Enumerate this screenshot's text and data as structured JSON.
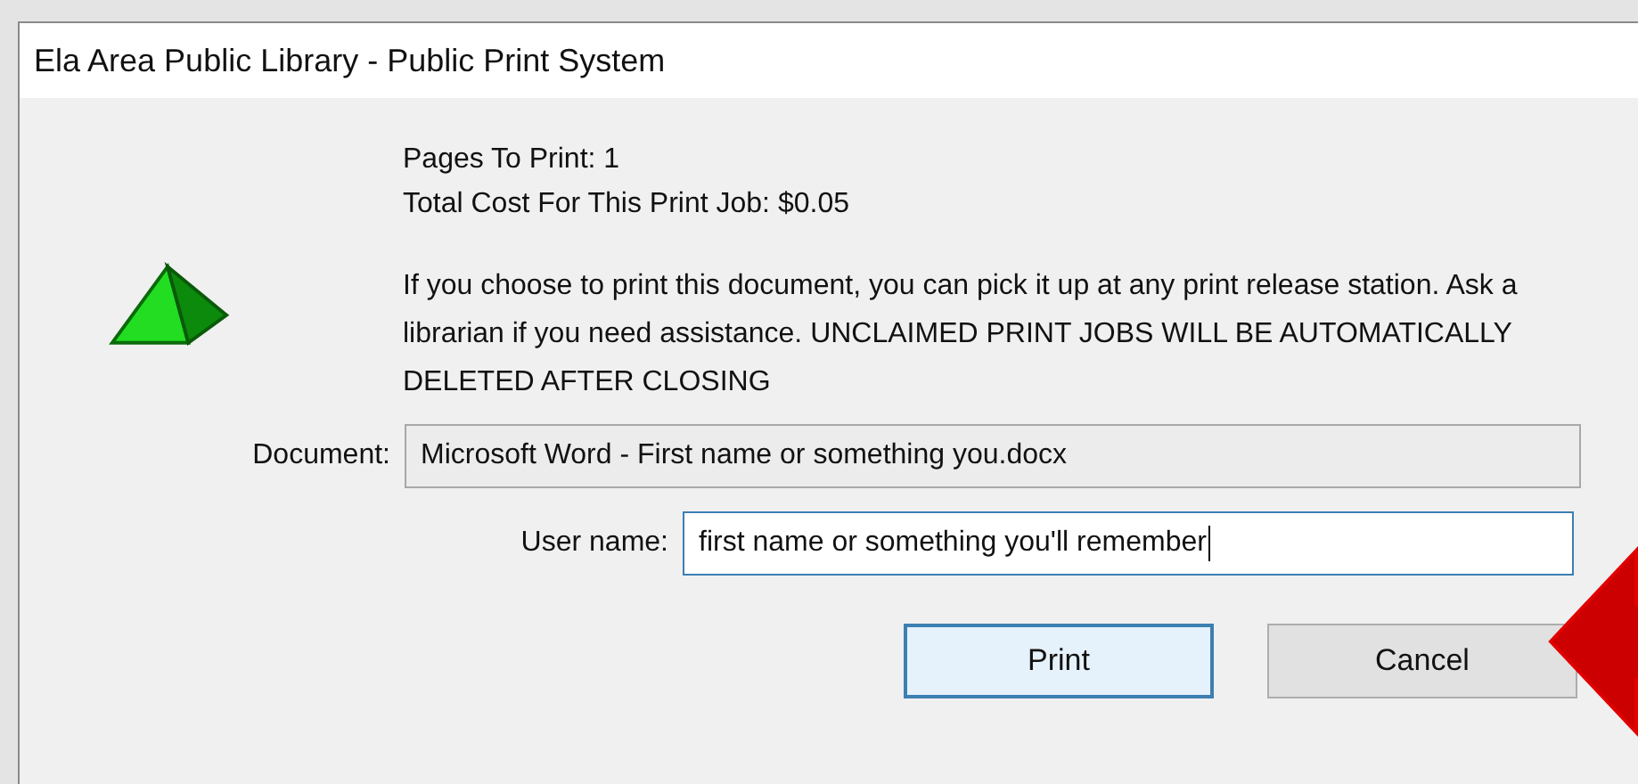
{
  "window": {
    "title": "Ela Area Public Library - Public Print System"
  },
  "summary": [
    "Pages To Print: 1",
    "Total Cost For This Print Job: $0.05"
  ],
  "message": "If you choose to print this document, you can pick it up at any print release station. Ask a librarian if you need assistance. UNCLAIMED PRINT JOBS WILL BE AUTOMATICALLY DELETED AFTER CLOSING",
  "document": {
    "label": "Document:",
    "value": "Microsoft Word - First name or something you.docx"
  },
  "user_name": {
    "label": "User name:",
    "value": "first name or something you'll remember",
    "focused": true
  },
  "buttons": [
    {
      "label": "Print",
      "default": true
    },
    {
      "label": "Cancel",
      "default": false
    }
  ]
}
